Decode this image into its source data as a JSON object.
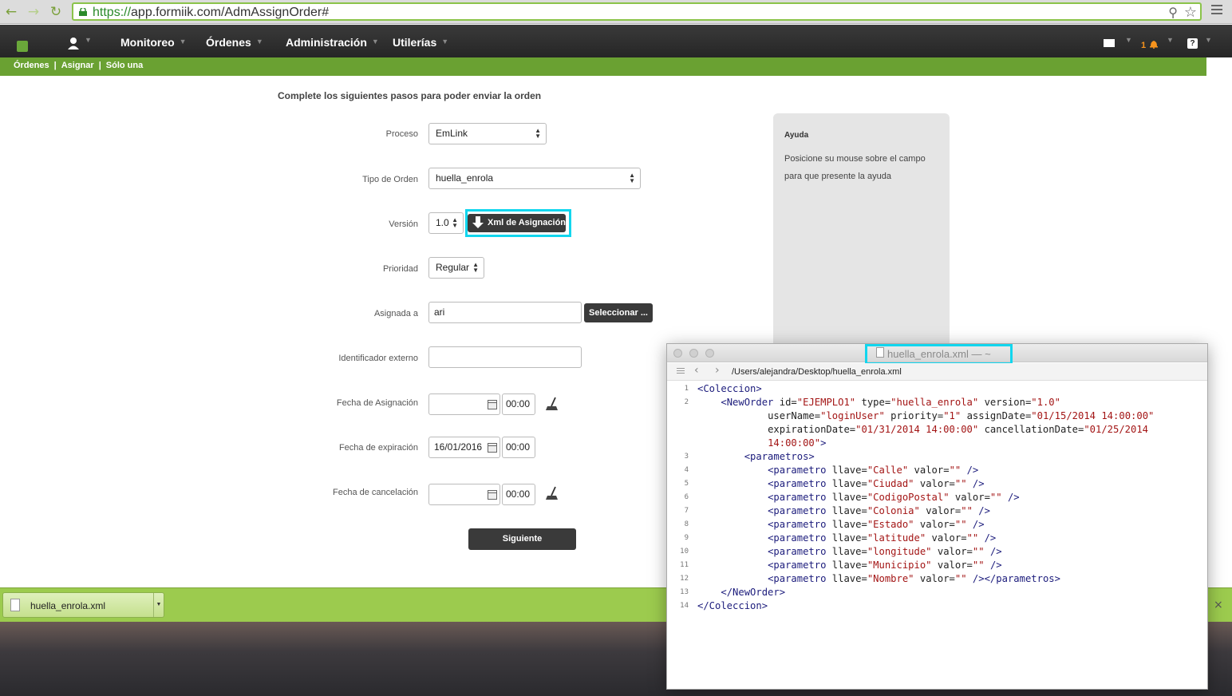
{
  "browser": {
    "url_https": "https://",
    "url_rest": "app.formiik.com/AdmAssignOrder#"
  },
  "nav": {
    "items": [
      "Monitoreo",
      "Órdenes",
      "Administración",
      "Utilerías"
    ],
    "notification_count": "1",
    "help_label": "?"
  },
  "breadcrumb": [
    "Órdenes",
    "Asignar",
    "Sólo una"
  ],
  "breadcrumb_sep": "|",
  "form": {
    "heading": "Complete los siguientes pasos para poder enviar la orden",
    "proceso_label": "Proceso",
    "proceso_value": "EmLink",
    "tipo_label": "Tipo de Orden",
    "tipo_value": "huella_enrola",
    "version_label": "Versión",
    "version_value": "1.0",
    "xml_button": "Xml de Asignación",
    "prioridad_label": "Prioridad",
    "prioridad_value": "Regular",
    "asignada_label": "Asignada a",
    "asignada_value": "ari",
    "seleccionar_button": "Seleccionar ...",
    "identificador_label": "Identificador externo",
    "identificador_value": "",
    "fecha_asignacion_label": "Fecha de Asignación",
    "fecha_asignacion_date": "",
    "fecha_asignacion_time": "00:00",
    "fecha_expiracion_label": "Fecha de expiración",
    "fecha_expiracion_date": "16/01/2016",
    "fecha_expiracion_time": "00:00",
    "fecha_cancelacion_label": "Fecha de cancelación",
    "fecha_cancelacion_date": "",
    "fecha_cancelacion_time": "00:00",
    "next_button": "Siguiente"
  },
  "help": {
    "title": "Ayuda",
    "text": "Posicione su mouse sobre el campo para que presente la ayuda"
  },
  "download": {
    "filename": "huella_enrola.xml",
    "close": "×"
  },
  "editor": {
    "title": "huella_enrola.xml — ~",
    "path": "/Users/alejandra/Desktop/huella_enrola.xml",
    "lines": [
      {
        "num": "1",
        "html": "<span class=\"tag\">&lt;Coleccion&gt;</span>"
      },
      {
        "num": "2",
        "html": "    <span class=\"tag\">&lt;NewOrder</span> <span class=\"attr\">id=</span><span class=\"val\">\"EJEMPLO1\"</span> <span class=\"attr\">type=</span><span class=\"val\">\"huella_enrola\"</span> <span class=\"attr\">version=</span><span class=\"val\">\"1.0\"</span>"
      },
      {
        "num": "",
        "html": "            <span class=\"attr\">userName=</span><span class=\"val\">\"loginUser\"</span> <span class=\"attr\">priority=</span><span class=\"val\">\"1\"</span> <span class=\"attr\">assignDate=</span><span class=\"val\">\"01/15/2014 14:00:00\"</span>"
      },
      {
        "num": "",
        "html": "            <span class=\"attr\">expirationDate=</span><span class=\"val\">\"01/31/2014 14:00:00\"</span> <span class=\"attr\">cancellationDate=</span><span class=\"val\">\"01/25/2014</span>"
      },
      {
        "num": "",
        "html": "            <span class=\"val\">14:00:00\"</span><span class=\"tag\">&gt;</span>"
      },
      {
        "num": "3",
        "html": "        <span class=\"tag\">&lt;parametros&gt;</span>"
      },
      {
        "num": "4",
        "html": "            <span class=\"tag\">&lt;parametro</span> <span class=\"attr\">llave=</span><span class=\"val\">\"Calle\"</span> <span class=\"attr\">valor=</span><span class=\"val\">\"\"</span> <span class=\"tag\">/&gt;</span>"
      },
      {
        "num": "5",
        "html": "            <span class=\"tag\">&lt;parametro</span> <span class=\"attr\">llave=</span><span class=\"val\">\"Ciudad\"</span> <span class=\"attr\">valor=</span><span class=\"val\">\"\"</span> <span class=\"tag\">/&gt;</span>"
      },
      {
        "num": "6",
        "html": "            <span class=\"tag\">&lt;parametro</span> <span class=\"attr\">llave=</span><span class=\"val\">\"CodigoPostal\"</span> <span class=\"attr\">valor=</span><span class=\"val\">\"\"</span> <span class=\"tag\">/&gt;</span>"
      },
      {
        "num": "7",
        "html": "            <span class=\"tag\">&lt;parametro</span> <span class=\"attr\">llave=</span><span class=\"val\">\"Colonia\"</span> <span class=\"attr\">valor=</span><span class=\"val\">\"\"</span> <span class=\"tag\">/&gt;</span>"
      },
      {
        "num": "8",
        "html": "            <span class=\"tag\">&lt;parametro</span> <span class=\"attr\">llave=</span><span class=\"val\">\"Estado\"</span> <span class=\"attr\">valor=</span><span class=\"val\">\"\"</span> <span class=\"tag\">/&gt;</span>"
      },
      {
        "num": "9",
        "html": "            <span class=\"tag\">&lt;parametro</span> <span class=\"attr\">llave=</span><span class=\"val\">\"latitude\"</span> <span class=\"attr\">valor=</span><span class=\"val\">\"\"</span> <span class=\"tag\">/&gt;</span>"
      },
      {
        "num": "10",
        "html": "            <span class=\"tag\">&lt;parametro</span> <span class=\"attr\">llave=</span><span class=\"val\">\"longitude\"</span> <span class=\"attr\">valor=</span><span class=\"val\">\"\"</span> <span class=\"tag\">/&gt;</span>"
      },
      {
        "num": "11",
        "html": "            <span class=\"tag\">&lt;parametro</span> <span class=\"attr\">llave=</span><span class=\"val\">\"Municipio\"</span> <span class=\"attr\">valor=</span><span class=\"val\">\"\"</span> <span class=\"tag\">/&gt;</span>"
      },
      {
        "num": "12",
        "html": "            <span class=\"tag\">&lt;parametro</span> <span class=\"attr\">llave=</span><span class=\"val\">\"Nombre\"</span> <span class=\"attr\">valor=</span><span class=\"val\">\"\"</span> <span class=\"tag\">/&gt;&lt;/parametros&gt;</span>"
      },
      {
        "num": "13",
        "html": "    <span class=\"tag\">&lt;/NewOrder&gt;</span>"
      },
      {
        "num": "14",
        "html": "<span class=\"tag\">&lt;/Coleccion&gt;</span>"
      }
    ]
  }
}
